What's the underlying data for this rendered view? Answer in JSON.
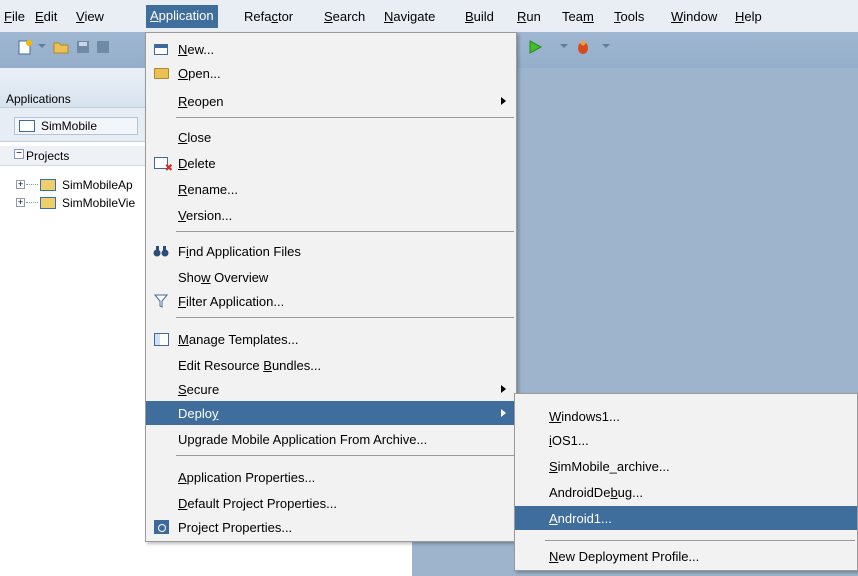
{
  "menubar": {
    "items": [
      {
        "label": "File",
        "u": "F",
        "rest": "ile"
      },
      {
        "label": "Edit",
        "u": "E",
        "rest": "dit"
      },
      {
        "label": "View",
        "u": "V",
        "rest": "iew"
      },
      {
        "label": "Application",
        "u": "A",
        "rest": "pplication"
      },
      {
        "label": "Refactor",
        "pre": "Refa",
        "u": "c",
        "rest": "tor"
      },
      {
        "label": "Search",
        "u": "S",
        "rest": "earch"
      },
      {
        "label": "Navigate",
        "u": "N",
        "rest": "avigate"
      },
      {
        "label": "Build",
        "u": "B",
        "rest": "uild"
      },
      {
        "label": "Run",
        "u": "R",
        "rest": "un"
      },
      {
        "label": "Team",
        "pre": "Tea",
        "u": "m",
        "rest": ""
      },
      {
        "label": "Tools",
        "u": "T",
        "rest": "ools"
      },
      {
        "label": "Window",
        "u": "W",
        "rest": "indow"
      },
      {
        "label": "Help",
        "u": "H",
        "rest": "elp"
      }
    ]
  },
  "left_panel": {
    "title": "Applications",
    "app_selector": "SimMobile",
    "projects_label": "Projects",
    "tree": [
      "SimMobileAp",
      "SimMobileVie"
    ]
  },
  "application_menu": {
    "items": [
      {
        "pre": "",
        "u": "N",
        "rest": "ew...",
        "icon": "window-icon"
      },
      {
        "pre": "",
        "u": "O",
        "rest": "pen...",
        "icon": "folder-icon"
      },
      {
        "pre": "",
        "u": "R",
        "rest": "eopen",
        "submenu": true
      },
      {
        "pre": "",
        "u": "C",
        "rest": "lose"
      },
      {
        "pre": "",
        "u": "D",
        "rest": "elete",
        "icon": "delete-icon"
      },
      {
        "pre": "",
        "u": "R",
        "rest": "ename..."
      },
      {
        "pre": "",
        "u": "V",
        "rest": "ersion..."
      },
      {
        "pre": "F",
        "u": "i",
        "rest": "nd Application Files",
        "icon": "binoculars-icon"
      },
      {
        "pre": "Sho",
        "u": "w",
        "rest": " Overview"
      },
      {
        "pre": "",
        "u": "F",
        "rest": "ilter Application...",
        "icon": "filter-icon"
      },
      {
        "pre": "",
        "u": "M",
        "rest": "anage Templates...",
        "icon": "templates-icon"
      },
      {
        "pre": "Edit Resource ",
        "u": "B",
        "rest": "undles..."
      },
      {
        "pre": "",
        "u": "S",
        "rest": "ecure",
        "submenu": true
      },
      {
        "pre": "Deplo",
        "u": "y",
        "rest": "",
        "submenu": true,
        "highlighted": true
      },
      {
        "pre": "Upgrade Mobile Application From Archive...",
        "u": "",
        "rest": ""
      },
      {
        "pre": "",
        "u": "A",
        "rest": "pplication Properties..."
      },
      {
        "pre": "",
        "u": "D",
        "rest": "efault Project Properties..."
      },
      {
        "pre": "Pro",
        "u": "j",
        "rest": "ect Properties...",
        "icon": "properties-icon"
      }
    ]
  },
  "deploy_menu": {
    "items": [
      {
        "pre": "",
        "u": "W",
        "rest": "indows1..."
      },
      {
        "pre": "",
        "u": "i",
        "rest": "OS1..."
      },
      {
        "pre": "",
        "u": "S",
        "rest": "imMobile_archive..."
      },
      {
        "pre": "AndroidDe",
        "u": "b",
        "rest": "ug..."
      },
      {
        "pre": "",
        "u": "A",
        "rest": "ndroid1...",
        "highlighted": true
      },
      {
        "pre": "",
        "u": "N",
        "rest": "ew Deployment Profile..."
      }
    ]
  },
  "colors": {
    "highlight": "#3f6d9c",
    "workspace": "#9db4cc",
    "toolbar": "#9fb7d0"
  }
}
